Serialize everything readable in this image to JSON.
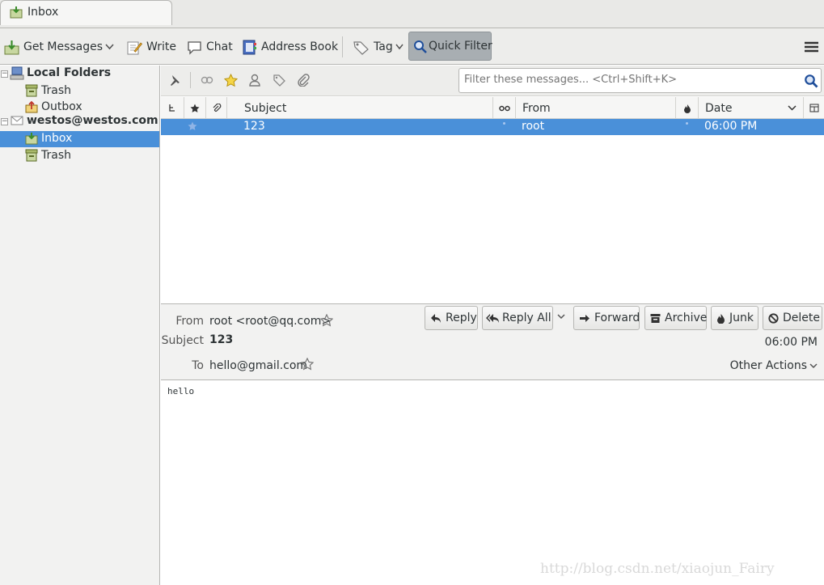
{
  "tab": {
    "title": "Inbox"
  },
  "toolbar": {
    "get_messages": "Get Messages",
    "write": "Write",
    "chat": "Chat",
    "address_book": "Address Book",
    "tag": "Tag",
    "quick_filter": "Quick Filter"
  },
  "folders": {
    "local_folders": "Local Folders",
    "local_trash": "Trash",
    "outbox": "Outbox",
    "account": "westos@westos.com",
    "inbox": "Inbox",
    "account_trash": "Trash"
  },
  "filter": {
    "placeholder": "Filter these messages... <Ctrl+Shift+K>"
  },
  "columns": {
    "subject": "Subject",
    "from": "From",
    "date": "Date"
  },
  "messages": [
    {
      "subject": "123",
      "from": "root",
      "date": "06:00 PM"
    }
  ],
  "message": {
    "from_label": "From",
    "from_value": "root <root@qq.com>",
    "subject_label": "Subject",
    "subject_value": "123",
    "to_label": "To",
    "to_value": "hello@gmail.com",
    "date": "06:00 PM",
    "other_actions": "Other Actions",
    "body": "hello"
  },
  "actions": {
    "reply": "Reply",
    "reply_all": "Reply All",
    "forward": "Forward",
    "archive": "Archive",
    "junk": "Junk",
    "delete": "Delete"
  },
  "watermark": "http://blog.csdn.net/xiaojun_Fairy",
  "colors": {
    "selection": "#4a90d9",
    "quick_filter_active": "#a8aeb2"
  }
}
